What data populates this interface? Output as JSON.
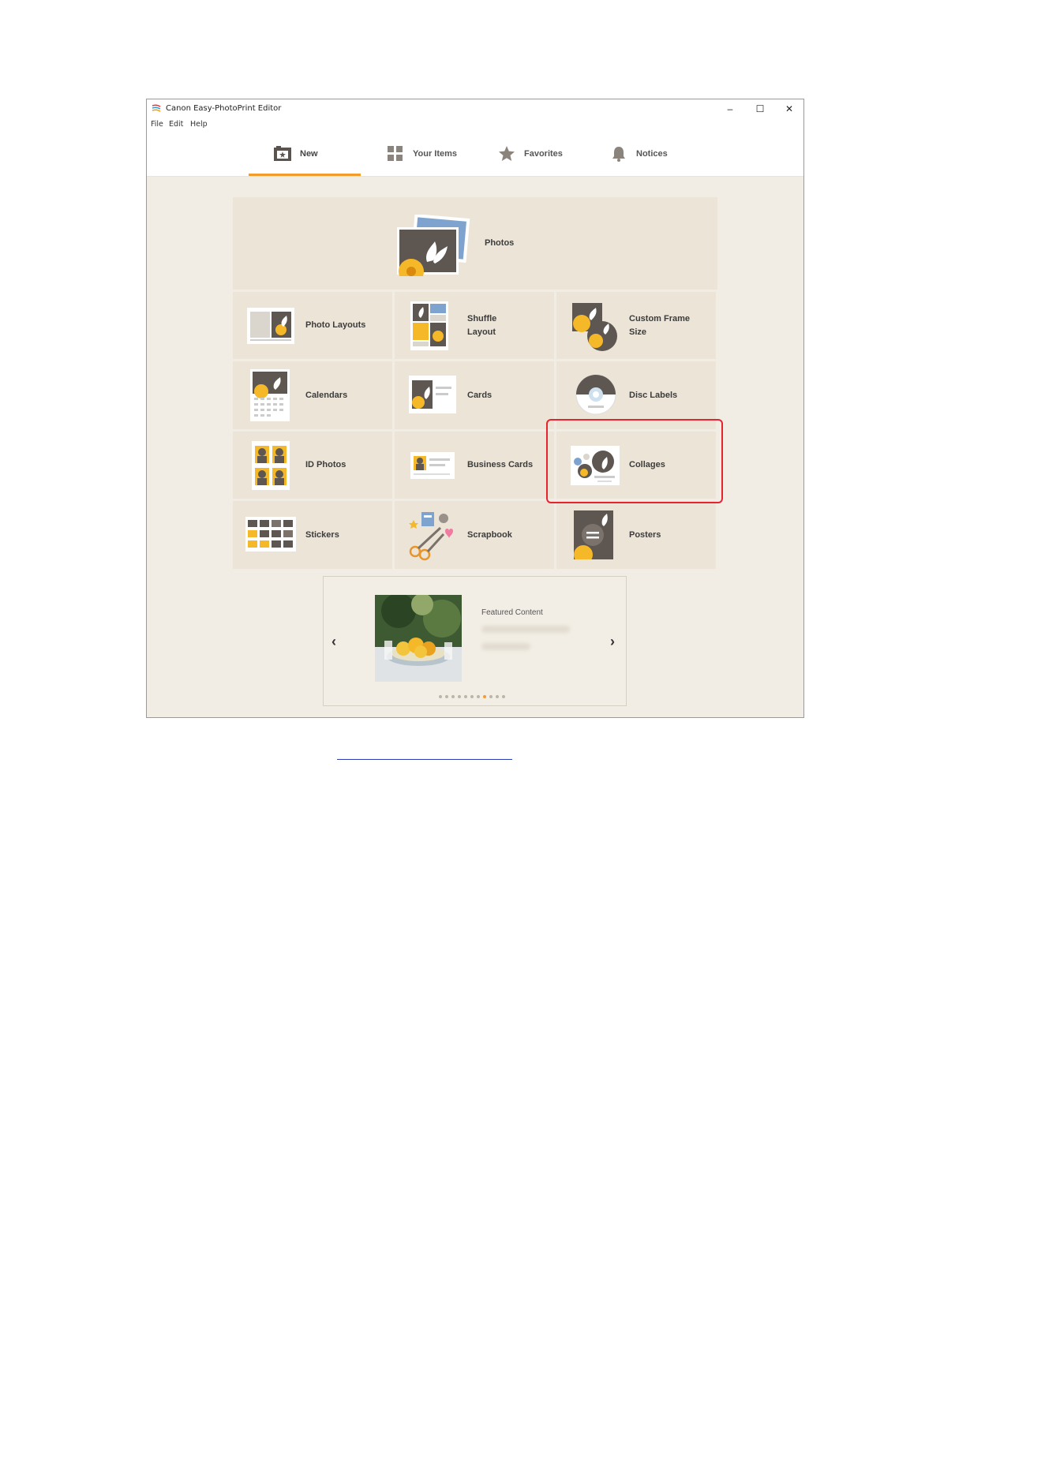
{
  "window": {
    "title": "Canon Easy-PhotoPrint Editor",
    "controls": {
      "minimize": "–",
      "maximize": "☐",
      "close": "✕"
    }
  },
  "menu": [
    "File",
    "Edit",
    "Help"
  ],
  "tabs": [
    {
      "label": "New",
      "icon": "new-project-icon",
      "active": true
    },
    {
      "label": "Your Items",
      "icon": "grid-icon",
      "active": false
    },
    {
      "label": "Favorites",
      "icon": "star-icon",
      "active": false
    },
    {
      "label": "Notices",
      "icon": "bell-icon",
      "active": false
    }
  ],
  "categories": {
    "photos": "Photos",
    "photo_layouts": "Photo Layouts",
    "shuffle_layout": [
      "Shuffle",
      "Layout"
    ],
    "custom_frame_size": [
      "Custom Frame",
      "Size"
    ],
    "calendars": "Calendars",
    "cards": "Cards",
    "disc_labels": "Disc Labels",
    "id_photos": "ID Photos",
    "business_cards": "Business Cards",
    "collages": "Collages",
    "stickers": "Stickers",
    "scrapbook": "Scrapbook",
    "posters": "Posters"
  },
  "featured": {
    "title": "Featured Content",
    "prev": "‹",
    "next": "›",
    "dot_count": 11,
    "active_dot": 7
  },
  "colors": {
    "accent": "#f39c2b",
    "highlight": "#e8222e",
    "background": "#f2ede4",
    "tile": "#ebe4d7",
    "photo_dark": "#5e5650",
    "flower": "#f5b829"
  }
}
